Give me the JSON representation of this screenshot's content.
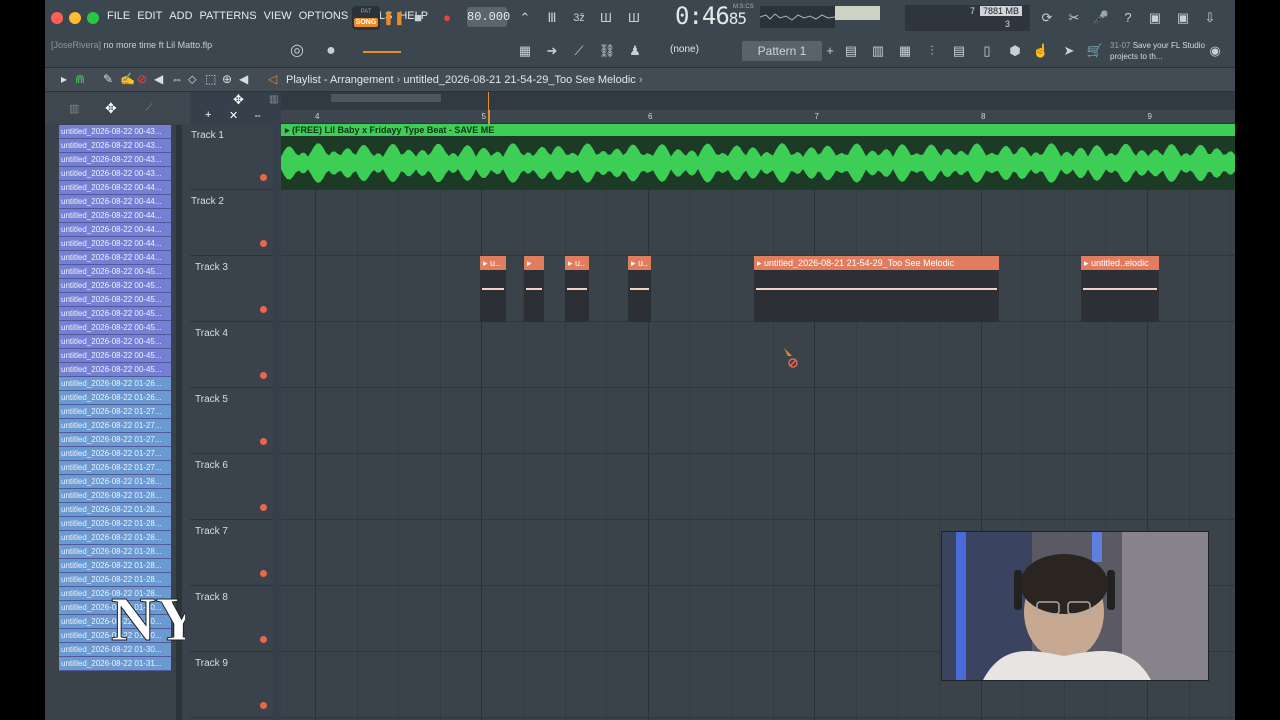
{
  "menu": [
    "FILE",
    "EDIT",
    "ADD",
    "PATTERNS",
    "VIEW",
    "OPTIONS",
    "TOOLS",
    "HELP"
  ],
  "mode": {
    "pat": "PAT",
    "song": "SONG"
  },
  "tempo": "80.000",
  "clock": {
    "time": "0:46",
    "frac": "85",
    "sub": "M:S:CS"
  },
  "cpu": {
    "a": "7",
    "mem": "7881 MB",
    "b": "3"
  },
  "user_hint": {
    "user": "[JoseRivera]",
    "text": "no more time ft Lil Matto.flp"
  },
  "channel": "(none)",
  "pattern": "Pattern 1",
  "right_hint": {
    "num": "31-07",
    "text": "Save your FL Studio projects to th..."
  },
  "playlist": {
    "title": "Playlist - Arrangement",
    "sep": "›",
    "project": "untitled_2026-08-21 21-54-29_Too See Melodic"
  },
  "ruler": [
    "4",
    "5",
    "6",
    "7",
    "8",
    "9"
  ],
  "picker_items": [
    {
      "label": "untitled_2026-08-22 00-43...",
      "color": "purple"
    },
    {
      "label": "untitled_2026-08-22 00-43...",
      "color": "purple"
    },
    {
      "label": "untitled_2026-08-22 00-43...",
      "color": "purple"
    },
    {
      "label": "untitled_2026-08-22 00-43...",
      "color": "purple"
    },
    {
      "label": "untitled_2026-08-22 00-44...",
      "color": "purple"
    },
    {
      "label": "untitled_2026-08-22 00-44...",
      "color": "purple"
    },
    {
      "label": "untitled_2026-08-22 00-44...",
      "color": "purple"
    },
    {
      "label": "untitled_2026-08-22 00-44...",
      "color": "purple"
    },
    {
      "label": "untitled_2026-08-22 00-44...",
      "color": "purple"
    },
    {
      "label": "untitled_2026-08-22 00-44...",
      "color": "purple"
    },
    {
      "label": "untitled_2026-08-22 00-45...",
      "color": "purple"
    },
    {
      "label": "untitled_2026-08-22 00-45...",
      "color": "purple"
    },
    {
      "label": "untitled_2026-08-22 00-45...",
      "color": "purple"
    },
    {
      "label": "untitled_2026-08-22 00-45...",
      "color": "purple"
    },
    {
      "label": "untitled_2026-08-22 00-45...",
      "color": "purple"
    },
    {
      "label": "untitled_2026-08-22 00-45...",
      "color": "purple"
    },
    {
      "label": "untitled_2026-08-22 00-45...",
      "color": "purple"
    },
    {
      "label": "untitled_2026-08-22 00-45...",
      "color": "purple"
    },
    {
      "label": "untitled_2026-08-22 01-26...",
      "color": "blue"
    },
    {
      "label": "untitled_2026-08-22 01-26...",
      "color": "blue"
    },
    {
      "label": "untitled_2026-08-22 01-27...",
      "color": "blue"
    },
    {
      "label": "untitled_2026-08-22 01-27...",
      "color": "blue"
    },
    {
      "label": "untitled_2026-08-22 01-27...",
      "color": "blue"
    },
    {
      "label": "untitled_2026-08-22 01-27...",
      "color": "blue"
    },
    {
      "label": "untitled_2026-08-22 01-27...",
      "color": "blue"
    },
    {
      "label": "untitled_2026-08-22 01-28...",
      "color": "blue"
    },
    {
      "label": "untitled_2026-08-22 01-28...",
      "color": "blue"
    },
    {
      "label": "untitled_2026-08-22 01-28...",
      "color": "blue"
    },
    {
      "label": "untitled_2026-08-22 01-28...",
      "color": "blue"
    },
    {
      "label": "untitled_2026-08-22 01-28...",
      "color": "blue"
    },
    {
      "label": "untitled_2026-08-22 01-28...",
      "color": "blue"
    },
    {
      "label": "untitled_2026-08-22 01-28...",
      "color": "blue"
    },
    {
      "label": "untitled_2026-08-22 01-28...",
      "color": "blue"
    },
    {
      "label": "untitled_2026-08-22 01-28...",
      "color": "blue"
    },
    {
      "label": "untitled_2026-08-22 01-30...",
      "color": "blue"
    },
    {
      "label": "untitled_2026-08-22 01-30...",
      "color": "blue"
    },
    {
      "label": "untitled_2026-08-22 01-30...",
      "color": "blue"
    },
    {
      "label": "untitled_2026-08-22 01-30...",
      "color": "blue"
    },
    {
      "label": "untitled_2026-08-22 01-31...",
      "color": "blue"
    }
  ],
  "tracks": [
    "Track 1",
    "Track 2",
    "Track 3",
    "Track 4",
    "Track 5",
    "Track 6",
    "Track 7",
    "Track 8",
    "Track 9"
  ],
  "clips": {
    "beat": "(FREE) Lil Baby x Fridayy Type Beat - SAVE ME",
    "small": [
      "u..",
      "",
      "u..",
      "u.."
    ],
    "long": "untitled_2026-08-21 21-54-29_Too See Melodic",
    "tail": "untitled..elodic"
  },
  "colors": {
    "accent": "#e98c2c",
    "audio_green": "#3dcf55",
    "clip_orange": "#e07d5f"
  }
}
